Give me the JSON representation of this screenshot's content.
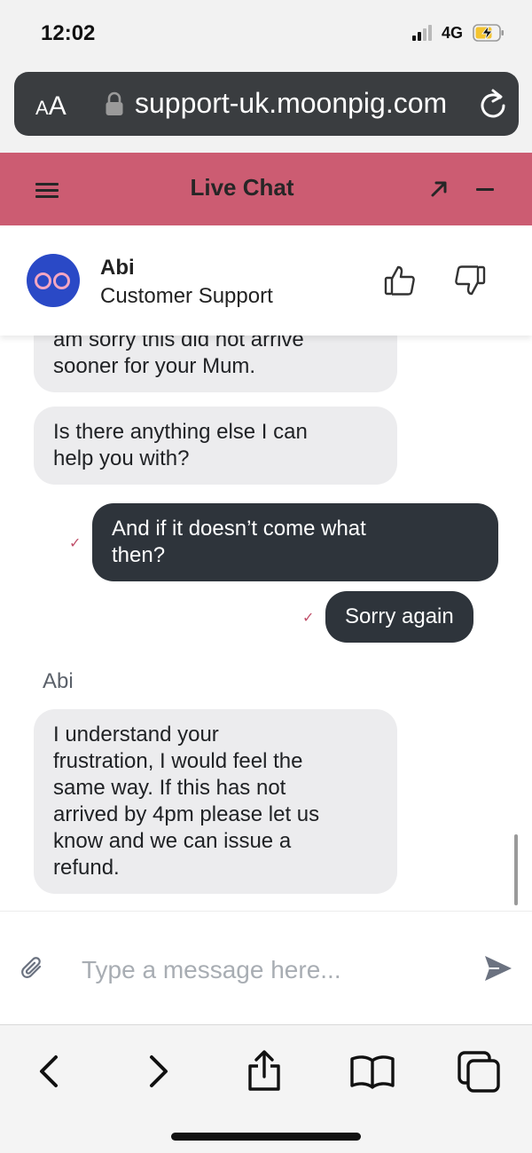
{
  "status_bar": {
    "time": "12:02",
    "network": "4G"
  },
  "browser": {
    "text_size_label_small": "A",
    "text_size_label_large": "A",
    "url": "support-uk.moonpig.com",
    "icons": [
      "lock-icon",
      "reload-icon"
    ]
  },
  "chat_header": {
    "title": "Live Chat",
    "icons": [
      "menu-icon",
      "popout-icon",
      "minimize-icon"
    ],
    "accent_color": "#cc5c72"
  },
  "agent": {
    "name": "Abi",
    "role": "Customer Support",
    "icons": [
      "avatar",
      "thumbs-up-icon",
      "thumbs-down-icon"
    ]
  },
  "messages": [
    {
      "from": "agent",
      "lines": [
        "am sorry this did not arrive",
        "sooner for your Mum."
      ]
    },
    {
      "from": "agent",
      "lines": [
        "Is there anything else I can",
        "help you with?"
      ]
    },
    {
      "from": "user",
      "lines": [
        "And if it doesn’t come what",
        "then?"
      ],
      "status": "✓"
    },
    {
      "from": "user",
      "lines": [
        "Sorry again"
      ],
      "status": "✓"
    },
    {
      "sender_label": "Abi"
    },
    {
      "from": "agent",
      "lines": [
        "I understand your",
        "frustration, I would feel the",
        "same way. If this has not",
        "arrived by 4pm please let us",
        "know and we can issue a",
        "refund."
      ]
    }
  ],
  "composer": {
    "placeholder": "Type a message here...",
    "icons": [
      "paperclip-icon",
      "send-icon"
    ]
  },
  "toolbar": {
    "icons": [
      "back-icon",
      "forward-icon",
      "share-icon",
      "bookmarks-icon",
      "tabs-icon"
    ]
  }
}
